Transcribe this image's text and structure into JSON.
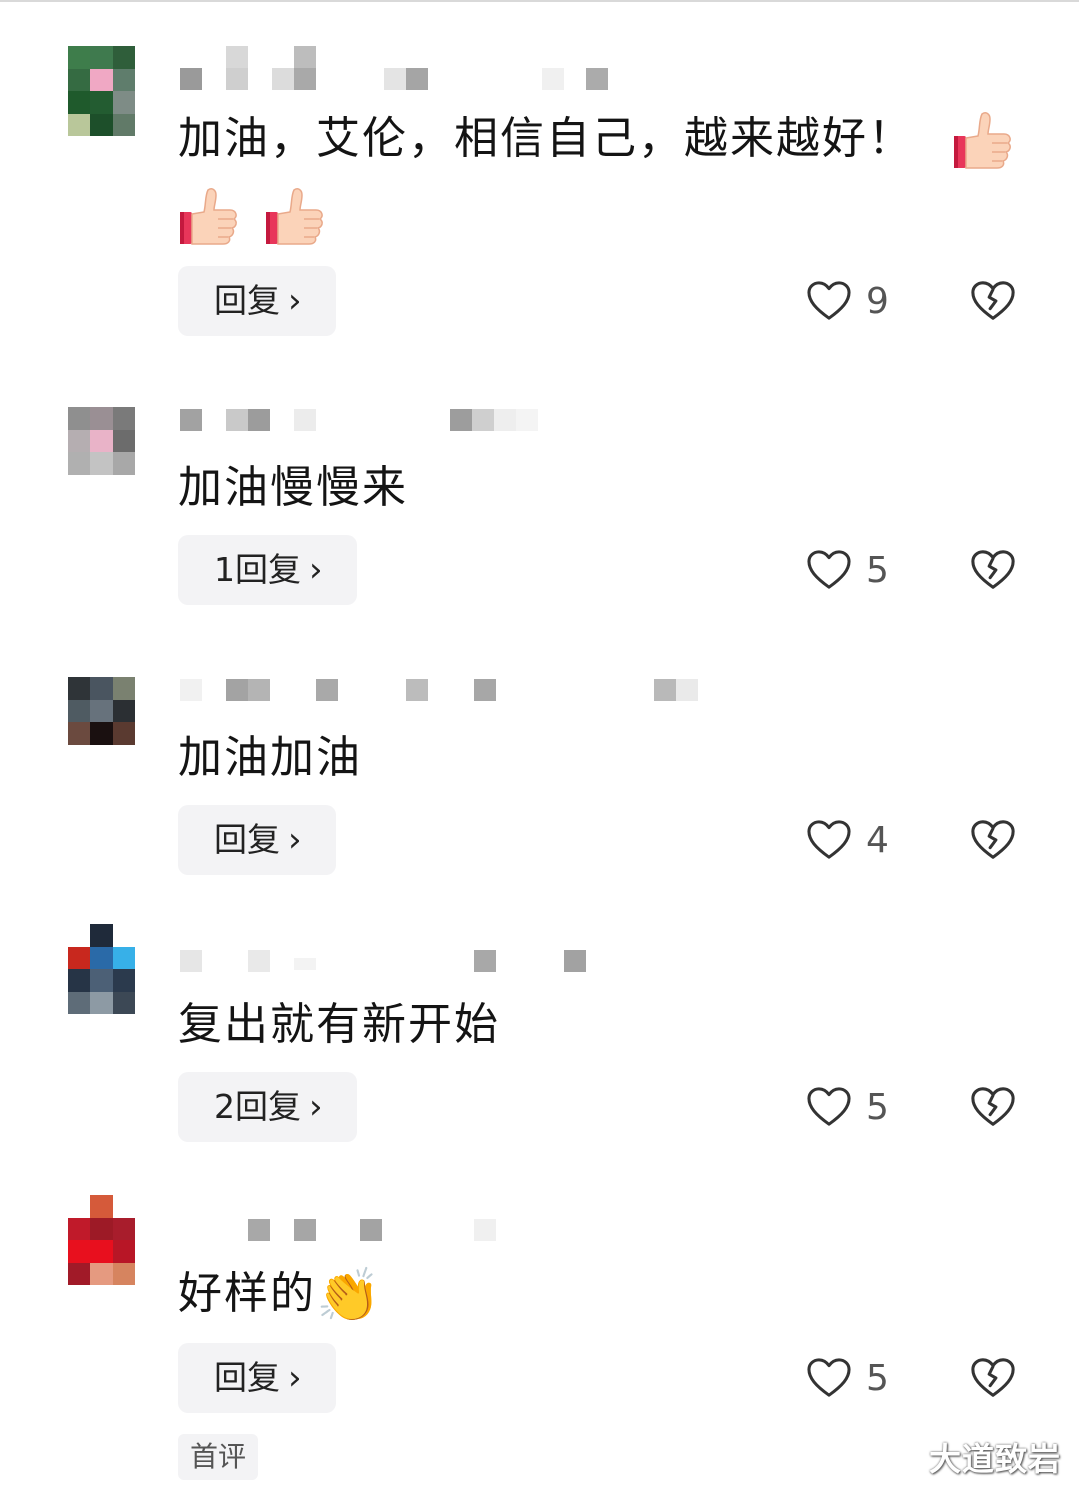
{
  "comments": [
    {
      "text": "加油，艾伦，相信自己，越来越好！",
      "text2": "",
      "reply_label": "回复",
      "likes": "9"
    },
    {
      "text": "加油慢慢来",
      "reply_label": "1回复",
      "likes": "5"
    },
    {
      "text": "加油加油",
      "reply_label": "回复",
      "likes": "4"
    },
    {
      "text": "复出就有新开始",
      "reply_label": "2回复",
      "likes": "5"
    },
    {
      "text": "好样的",
      "emoji": "👏",
      "reply_label": "回复",
      "likes": "5"
    }
  ],
  "badge": "首评",
  "watermark": "大道致岩",
  "icons": {
    "like": "heart-outline-icon",
    "dislike": "broken-heart-icon",
    "reply_chevron": "chevron-right-icon",
    "thumbs_up": "thumbs-up-emoji",
    "clap": "clapping-hands-emoji"
  },
  "colors": {
    "button_bg": "#f3f3f5",
    "text": "#141414",
    "icon": "#333333"
  }
}
